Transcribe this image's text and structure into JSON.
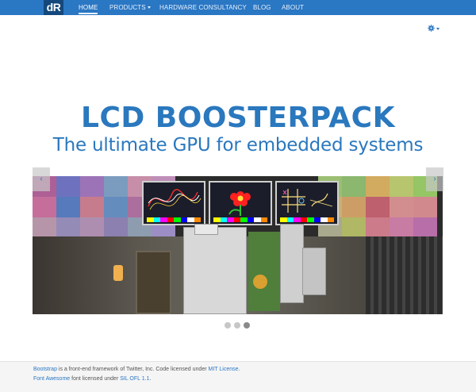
{
  "nav": {
    "brand": "dR",
    "items": [
      {
        "label": "HOME",
        "active": true
      },
      {
        "label": "PRODUCTS",
        "dropdown": true
      },
      {
        "label": "HARDWARE CONSULTANCY"
      },
      {
        "label": "BLOG"
      },
      {
        "label": "ABOUT"
      }
    ],
    "settings_icon": "gear-icon"
  },
  "hero": {
    "title": "LCD BOOSTERPACK",
    "subtitle": "The ultimate GPU for embedded systems"
  },
  "carousel": {
    "prev_icon": "chevron-left-icon",
    "next_icon": "chevron-right-icon",
    "prev_glyph": "‹",
    "next_glyph": "›",
    "slide_count": 3,
    "active_index": 2
  },
  "footer": {
    "line1": {
      "link1": "Bootstrap",
      "text1": " is a front-end framework of Twitter, Inc. Code licensed under ",
      "link2": "MIT License",
      "text2": "."
    },
    "line2": {
      "link1": "Font Awesome",
      "text1": " font licensed under ",
      "link2": "SIL OFL 1.1",
      "text2": "."
    }
  },
  "colors": {
    "accent": "#2a77c4",
    "brand_bg": "#14487d",
    "title": "#2a78be"
  }
}
